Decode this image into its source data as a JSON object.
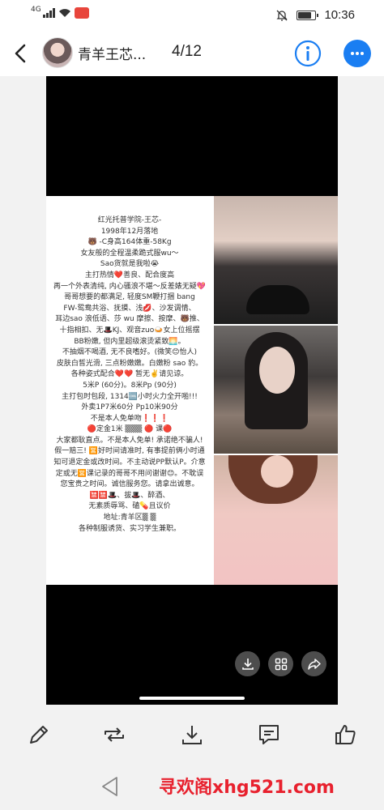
{
  "status_bar": {
    "network": "4G",
    "time": "10:36"
  },
  "header": {
    "title": "青羊王芯...",
    "counter": "4/12"
  },
  "poster": {
    "lines": [
      "红光托普学院-王芯-",
      "1998年12月落地",
      "🐻 -C身高164体重-58Kg",
      "女友般的全程温柔跪式服wu～",
      "Sao货就是我啦😭",
      "主打热情❤️善良、配合度高",
      "再一个外表清纯, 内心骚浪不堪～反差婊无疑💖",
      "哥哥想要的都满足, 轻度SM鞭打捆 bang",
      "FW-鸳鸯共浴、抚摸、浅💋、沙发调情、",
      "耳边sao 浪低语、莎 wu 摩擦、按摩、🐻推、",
      "十指相扣、无🎩KJ、观音zuo🍛女上位摇摆",
      "BB粉嫩, 但内里超级滚烫紧致🌅。",
      "不抽烟不喝酒, 无不良嗜好。(微笑😊怡人)",
      "皮肤白皙光滑, 三点粉嫩嫩。白嫩粉 sao 豹。",
      "各种姿式配合❤️❤️ 暂无✌️请见谅。",
      "5米P (60分)。8米Pp (90分)",
      "主打包时包段, 1314🆒小时火力全开啪!!!",
      "外卖1P7米60分 Pp10米90分",
      "不是本人免单吻❗❗❗",
      "🔴定金1米 ▒▒▒ 🔴 课🔴",
      "大家都耿直点。不是本人免单! 承诺绝不骗人!",
      "假一赔三! 🈺好时间请准时, 有事提前俩小时通",
      "知可退定金或改时间。不主动说PP默认P。介意",
      "定或无🈺课记录的哥哥不用问谢谢😊。不耽误",
      "您宝贵之时间。诚信服务您。请拿出诚意。",
      "🈲🈲🎩、拔🎩、醉酒、",
      "无素质辱骂、磕💊且议价",
      "地址:青羊区▒ ▒",
      "各种制服诱货、实习学生兼职。"
    ]
  },
  "viewer": {
    "download_label": "download",
    "grid_label": "grid",
    "share_label": "share"
  },
  "toolbar": {
    "items": [
      "edit",
      "repost",
      "download",
      "comment",
      "like"
    ]
  },
  "watermark": {
    "text": "寻欢阁xhg521.com"
  },
  "colors": {
    "accent": "#1a7ef2",
    "watermark": "#e8212e"
  }
}
